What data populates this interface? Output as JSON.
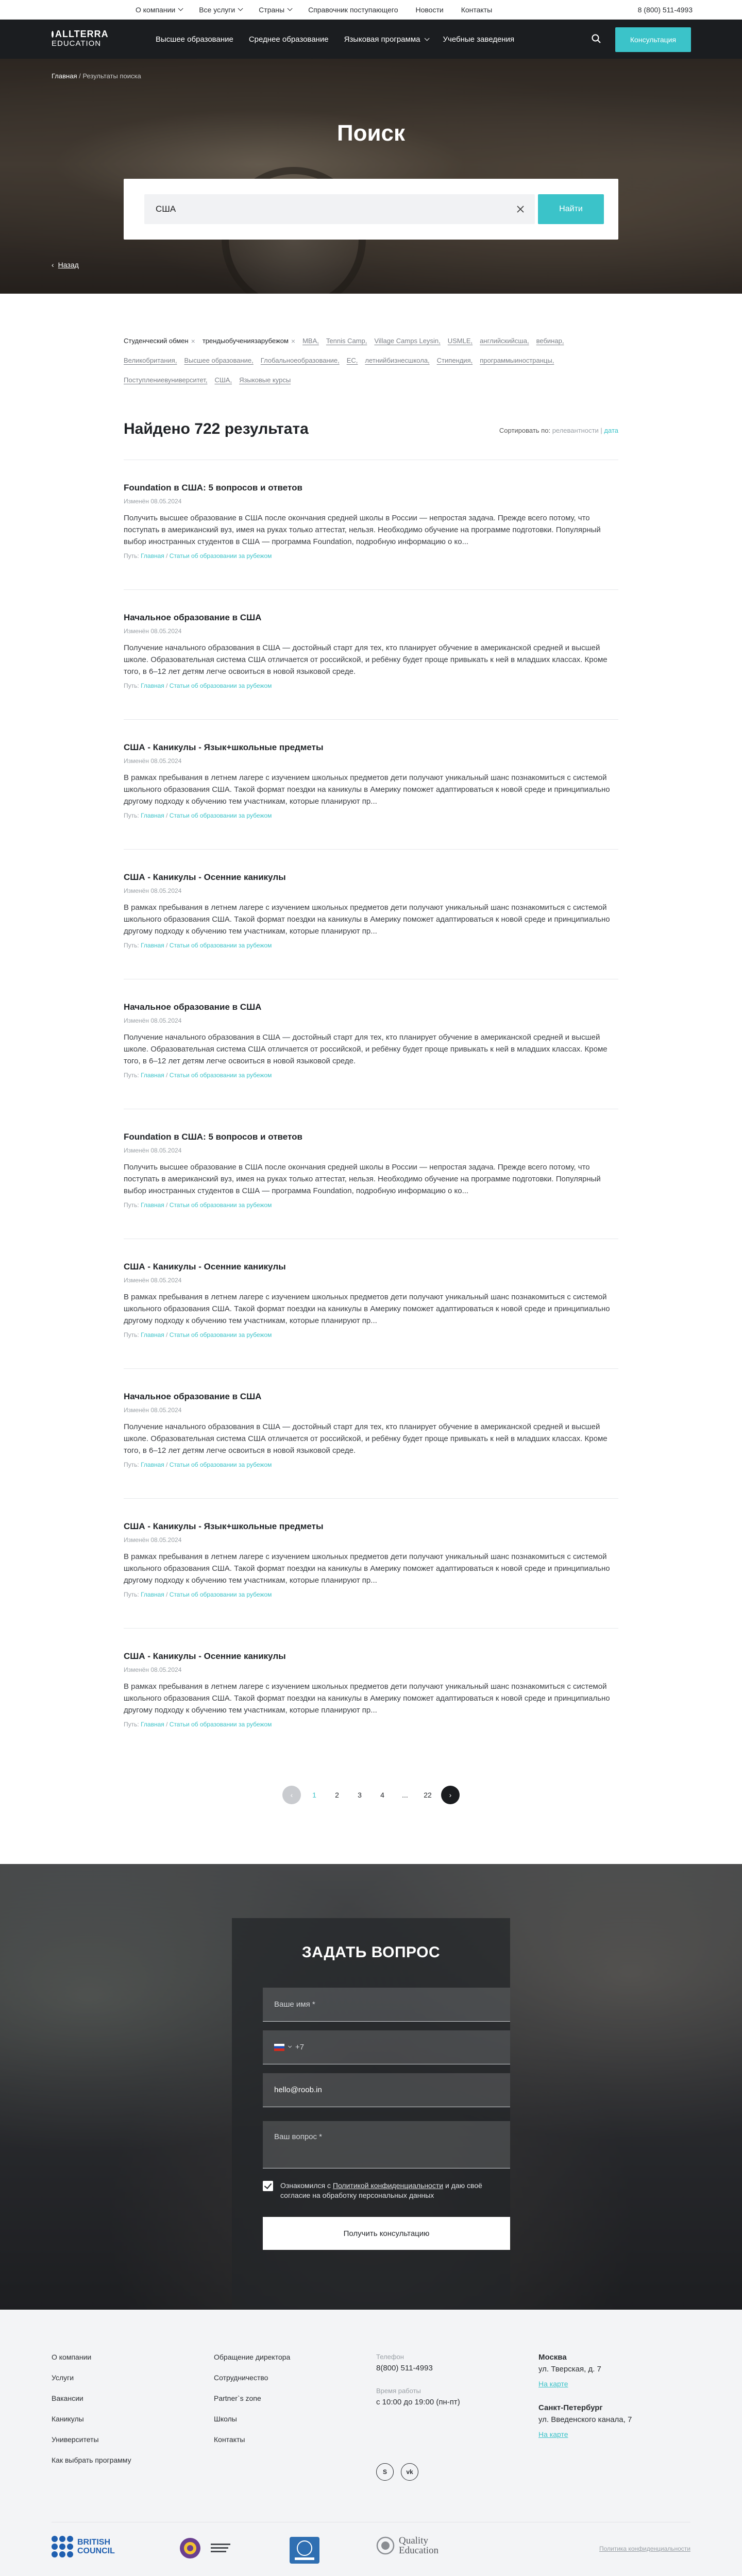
{
  "topbar": {
    "nav": [
      {
        "label": "О компании",
        "dropdown": true
      },
      {
        "label": "Все услуги",
        "dropdown": true
      },
      {
        "label": "Страны",
        "dropdown": true
      },
      {
        "label": "Справочник поступающего",
        "dropdown": false
      },
      {
        "label": "Новости",
        "dropdown": false
      },
      {
        "label": "Контакты",
        "dropdown": false
      }
    ],
    "phone": "8 (800) 511-4993"
  },
  "header": {
    "logo_line1": "ALLTERRA",
    "logo_line2": "EDUCATION",
    "nav": [
      {
        "label": "Высшее образование"
      },
      {
        "label": "Среднее образование"
      },
      {
        "label": "Языковая программа"
      },
      {
        "label": "Учебные заведения"
      }
    ],
    "consult_label": "Консультация"
  },
  "hero": {
    "breadcrumb_home": "Главная",
    "breadcrumb_sep": "/",
    "breadcrumb_current": "Результаты поиска",
    "title": "Поиск",
    "search_value": "США",
    "search_button": "Найти",
    "back_label": "Назад"
  },
  "tags": {
    "active": [
      "Студенческий обмен",
      "трендыобучениязарубежом"
    ],
    "items": [
      "MBA,",
      "Tennis Camp,",
      "Village Camps Leysin,",
      "USMLE,",
      "английскийсша,",
      "вебинар,",
      "Великобритания,",
      "Высшее образование,",
      "Глобальноеобразование,",
      "ЕС,",
      "летнийбизнесшкола,",
      "Стипендия,",
      "программыиностранцы,",
      "Поступлениевуниверситет,",
      "США,",
      "Языковые курсы"
    ]
  },
  "results": {
    "count_title": "Найдено 722 результата",
    "sort_label": "Сортировать по:",
    "sort_relevance": "релевантности",
    "sort_sep": "|",
    "sort_date": "дата",
    "path_label": "Путь:",
    "items": [
      {
        "title": "Foundation в США: 5 вопросов и ответов",
        "date": "Изменён 08.05.2024",
        "text": "Получить высшее образование в США после окончания средней школы в России — непростая задача. Прежде всего потому, что поступать в американский вуз, имея на руках только аттестат, нельзя. Необходимо обучение на программе подготовки. Популярный выбор иностранных студентов в США — программа Foundation, подробную информацию о ко...",
        "path_home": "Главная",
        "path_sep": "/",
        "path_section": "Статьи об образовании за рубежом"
      },
      {
        "title": "Начальное образование в США",
        "date": "Изменён 08.05.2024",
        "text": "Получение начального образования в США — достойный старт для тех, кто планирует обучение в американской средней и высшей школе. Образовательная система США отличается от российской, и ребёнку будет проще привыкать к ней в младших классах. Кроме того, в 6–12 лет детям легче освоиться в новой языковой среде.",
        "path_home": "Главная",
        "path_sep": "/",
        "path_section": "Статьи об образовании за рубежом"
      },
      {
        "title": "США - Каникулы - Язык+школьные предметы",
        "date": "Изменён 08.05.2024",
        "text": "В рамках пребывания в летнем лагере с изучением школьных предметов дети получают уникальный шанс познакомиться с системой школьного образования США. Такой формат поездки на каникулы в Америку поможет адаптироваться к новой среде и принципиально другому подходу к обучению тем участникам, которые планируют пр...",
        "path_home": "Главная",
        "path_sep": "/",
        "path_section": "Статьи об образовании за рубежом"
      },
      {
        "title": "США - Каникулы - Осенние каникулы",
        "date": "Изменён 08.05.2024",
        "text": "В рамках пребывания в летнем лагере с изучением школьных предметов дети получают уникальный шанс познакомиться с системой школьного образования США. Такой формат поездки на каникулы в Америку поможет адаптироваться к новой среде и принципиально другому подходу к обучению тем участникам, которые планируют пр...",
        "path_home": "Главная",
        "path_sep": "/",
        "path_section": "Статьи об образовании за рубежом"
      },
      {
        "title": "Начальное образование в США",
        "date": "Изменён 08.05.2024",
        "text": "Получение начального образования в США — достойный старт для тех, кто планирует обучение в американской средней и высшей школе. Образовательная система США отличается от российской, и ребёнку будет проще привыкать к ней в младших классах. Кроме того, в 6–12 лет детям легче освоиться в новой языковой среде.",
        "path_home": "Главная",
        "path_sep": "/",
        "path_section": "Статьи об образовании за рубежом"
      },
      {
        "title": "Foundation в США: 5 вопросов и ответов",
        "date": "Изменён 08.05.2024",
        "text": "Получить высшее образование в США после окончания средней школы в России — непростая задача. Прежде всего потому, что поступать в американский вуз, имея на руках только аттестат, нельзя. Необходимо обучение на программе подготовки. Популярный выбор иностранных студентов в США — программа Foundation, подробную информацию о ко...",
        "path_home": "Главная",
        "path_sep": "/",
        "path_section": "Статьи об образовании за рубежом"
      },
      {
        "title": "США - Каникулы - Осенние каникулы",
        "date": "Изменён 08.05.2024",
        "text": "В рамках пребывания в летнем лагере с изучением школьных предметов дети получают уникальный шанс познакомиться с системой школьного образования США. Такой формат поездки на каникулы в Америку поможет адаптироваться к новой среде и принципиально другому подходу к обучению тем участникам, которые планируют пр...",
        "path_home": "Главная",
        "path_sep": "/",
        "path_section": "Статьи об образовании за рубежом"
      },
      {
        "title": "Начальное образование в США",
        "date": "Изменён 08.05.2024",
        "text": "Получение начального образования в США — достойный старт для тех, кто планирует обучение в американской средней и высшей школе. Образовательная система США отличается от российской, и ребёнку будет проще привыкать к ней в младших классах. Кроме того, в 6–12 лет детям легче освоиться в новой языковой среде.",
        "path_home": "Главная",
        "path_sep": "/",
        "path_section": "Статьи об образовании за рубежом"
      },
      {
        "title": "США - Каникулы - Язык+школьные предметы",
        "date": "Изменён 08.05.2024",
        "text": "В рамках пребывания в летнем лагере с изучением школьных предметов дети получают уникальный шанс познакомиться с системой школьного образования США. Такой формат поездки на каникулы в Америку поможет адаптироваться к новой среде и принципиально другому подходу к обучению тем участникам, которые планируют пр...",
        "path_home": "Главная",
        "path_sep": "/",
        "path_section": "Статьи об образовании за рубежом"
      },
      {
        "title": "США - Каникулы - Осенние каникулы",
        "date": "Изменён 08.05.2024",
        "text": "В рамках пребывания в летнем лагере с изучением школьных предметов дети получают уникальный шанс познакомиться с системой школьного образования США. Такой формат поездки на каникулы в Америку поможет адаптироваться к новой среде и принципиально другому подходу к обучению тем участникам, которые планируют пр...",
        "path_home": "Главная",
        "path_sep": "/",
        "path_section": "Статьи об образовании за рубежом"
      }
    ]
  },
  "pagination": {
    "pages": [
      "1",
      "2",
      "3",
      "4",
      "...",
      "22"
    ],
    "current": "1"
  },
  "ask": {
    "title": "ЗАДАТЬ ВОПРОС",
    "name_placeholder": "Ваше имя *",
    "phone_prefix": "+7",
    "email_value": "hello@roob.in",
    "question_placeholder": "Ваш вопрос *",
    "agree_pre": "Ознакомился с",
    "agree_link": "Политикой конфиденциальности",
    "agree_post": "и даю своё согласие на обработку персональных данных",
    "submit": "Получить консультацию"
  },
  "footer": {
    "col1": [
      "О компании",
      "Услуги",
      "Вакансии",
      "Каникулы",
      "Университеты",
      "Как выбрать программу"
    ],
    "col2": [
      "Обращение директора",
      "Сотрудничество",
      "Partner`s zone",
      "Школы",
      "Контакты"
    ],
    "phone_label": "Телефон",
    "phone": "8(800) 511-4993",
    "hours_label": "Время работы",
    "hours": "с 10:00 до 19:00 (пн-пт)",
    "social_icons": [
      "skype-icon",
      "vk-icon"
    ],
    "social_glyphs": [
      "S",
      "vk"
    ],
    "offices": [
      {
        "city": "Москва",
        "address": "ул. Тверская, д. 7",
        "map": "На карте"
      },
      {
        "city": "Санкт-Петербург",
        "address": "ул. Введенского канала, 7",
        "map": "На карте"
      }
    ],
    "partners": {
      "british_council_l1": "BRITISH",
      "british_council_l2": "COUNCIL",
      "quality_l1": "Quality",
      "quality_l2": "Education"
    },
    "policy": "Политика конфиденциальности"
  },
  "colors": {
    "accent": "#3bc3c9",
    "dark": "#1b1d20"
  }
}
